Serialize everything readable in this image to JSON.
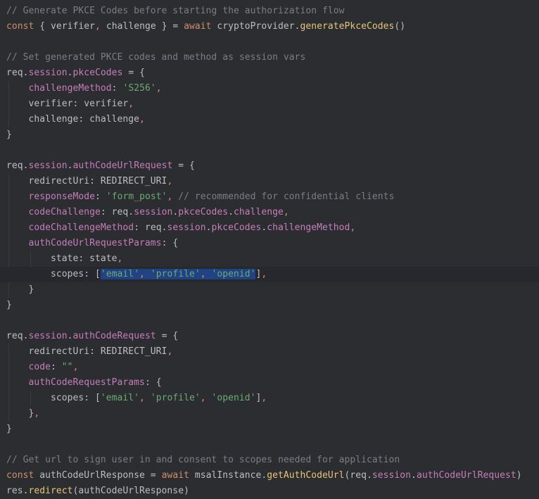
{
  "colors": {
    "background": "#2b2d30",
    "current_line": "#26282e",
    "selection": "#214283",
    "comment": "#7a7e85",
    "keyword": "#cf8e6d",
    "function": "#e8c57a",
    "property": "#c77dbb",
    "string": "#6aab73",
    "plain": "#bcbec4",
    "indent_guide": "#393b40"
  },
  "editor": {
    "current_line": 17,
    "lines": [
      [
        [
          "comment",
          "// Generate PKCE Codes before starting the authorization flow"
        ]
      ],
      [
        [
          "keyword",
          "const"
        ],
        [
          "plain",
          " { verifier"
        ],
        [
          "keyword",
          ","
        ],
        [
          "plain",
          " challenge } = "
        ],
        [
          "keyword",
          "await"
        ],
        [
          "plain",
          " cryptoProvider."
        ],
        [
          "func",
          "generatePkceCodes"
        ],
        [
          "plain",
          "()"
        ]
      ],
      [],
      [
        [
          "comment",
          "// Set generated PKCE codes and method as session vars"
        ]
      ],
      [
        [
          "plain",
          "req."
        ],
        [
          "prop",
          "session"
        ],
        [
          "plain",
          "."
        ],
        [
          "prop",
          "pkceCodes"
        ],
        [
          "plain",
          " = {"
        ]
      ],
      [
        [
          "plain",
          "    "
        ],
        [
          "prop",
          "challengeMethod"
        ],
        [
          "plain",
          ": "
        ],
        [
          "string",
          "'S256'"
        ],
        [
          "keyword",
          ","
        ]
      ],
      [
        [
          "plain",
          "    verifier: verifier"
        ],
        [
          "keyword",
          ","
        ]
      ],
      [
        [
          "plain",
          "    challenge: challenge"
        ],
        [
          "keyword",
          ","
        ]
      ],
      [
        [
          "plain",
          "}"
        ]
      ],
      [],
      [
        [
          "plain",
          "req."
        ],
        [
          "prop",
          "session"
        ],
        [
          "plain",
          "."
        ],
        [
          "prop",
          "authCodeUrlRequest"
        ],
        [
          "plain",
          " = {"
        ]
      ],
      [
        [
          "plain",
          "    redirectUri: REDIRECT_URI"
        ],
        [
          "keyword",
          ","
        ]
      ],
      [
        [
          "plain",
          "    "
        ],
        [
          "prop",
          "responseMode"
        ],
        [
          "plain",
          ": "
        ],
        [
          "string",
          "'form_post'"
        ],
        [
          "keyword",
          ","
        ],
        [
          "plain",
          " "
        ],
        [
          "comment",
          "// recommended for confidential clients"
        ]
      ],
      [
        [
          "plain",
          "    "
        ],
        [
          "prop",
          "codeChallenge"
        ],
        [
          "plain",
          ": req."
        ],
        [
          "prop",
          "session"
        ],
        [
          "plain",
          "."
        ],
        [
          "prop",
          "pkceCodes"
        ],
        [
          "plain",
          "."
        ],
        [
          "prop",
          "challenge"
        ],
        [
          "keyword",
          ","
        ]
      ],
      [
        [
          "plain",
          "    "
        ],
        [
          "prop",
          "codeChallengeMethod"
        ],
        [
          "plain",
          ": req."
        ],
        [
          "prop",
          "session"
        ],
        [
          "plain",
          "."
        ],
        [
          "prop",
          "pkceCodes"
        ],
        [
          "plain",
          "."
        ],
        [
          "prop",
          "challengeMethod"
        ],
        [
          "keyword",
          ","
        ]
      ],
      [
        [
          "plain",
          "    "
        ],
        [
          "prop",
          "authCodeUrlRequestParams"
        ],
        [
          "plain",
          ": {"
        ]
      ],
      [
        [
          "plain",
          "        state: state"
        ],
        [
          "keyword",
          ","
        ]
      ],
      [
        [
          "plain",
          "        scopes: ["
        ],
        [
          "string",
          "'email'",
          "sel"
        ],
        [
          "keyword",
          ", ",
          "sel"
        ],
        [
          "string",
          "'profile'",
          "sel"
        ],
        [
          "keyword",
          ", ",
          "sel"
        ],
        [
          "string",
          "'openid'",
          "sel"
        ],
        [
          "plain",
          "]"
        ],
        [
          "keyword",
          ","
        ]
      ],
      [
        [
          "plain",
          "    }"
        ]
      ],
      [
        [
          "plain",
          "}"
        ]
      ],
      [],
      [
        [
          "plain",
          "req."
        ],
        [
          "prop",
          "session"
        ],
        [
          "plain",
          "."
        ],
        [
          "prop",
          "authCodeRequest"
        ],
        [
          "plain",
          " = {"
        ]
      ],
      [
        [
          "plain",
          "    redirectUri: REDIRECT_URI"
        ],
        [
          "keyword",
          ","
        ]
      ],
      [
        [
          "plain",
          "    "
        ],
        [
          "prop",
          "code"
        ],
        [
          "plain",
          ": "
        ],
        [
          "string",
          "\"\""
        ],
        [
          "keyword",
          ","
        ]
      ],
      [
        [
          "plain",
          "    "
        ],
        [
          "prop",
          "authCodeRequestParams"
        ],
        [
          "plain",
          ": {"
        ]
      ],
      [
        [
          "plain",
          "        scopes: ["
        ],
        [
          "string",
          "'email'"
        ],
        [
          "keyword",
          ", "
        ],
        [
          "string",
          "'profile'"
        ],
        [
          "keyword",
          ", "
        ],
        [
          "string",
          "'openid'"
        ],
        [
          "plain",
          "]"
        ],
        [
          "keyword",
          ","
        ]
      ],
      [
        [
          "plain",
          "    }"
        ],
        [
          "keyword",
          ","
        ]
      ],
      [
        [
          "plain",
          "}"
        ]
      ],
      [],
      [
        [
          "comment",
          "// Get url to sign user in and consent to scopes needed for application"
        ]
      ],
      [
        [
          "keyword",
          "const"
        ],
        [
          "plain",
          " authCodeUrlResponse = "
        ],
        [
          "keyword",
          "await"
        ],
        [
          "plain",
          " msalInstance."
        ],
        [
          "func",
          "getAuthCodeUrl"
        ],
        [
          "plain",
          "(req."
        ],
        [
          "prop",
          "session"
        ],
        [
          "plain",
          "."
        ],
        [
          "prop",
          "authCodeUrlRequest"
        ],
        [
          "plain",
          ")"
        ]
      ],
      [
        [
          "plain",
          "res."
        ],
        [
          "func",
          "redirect"
        ],
        [
          "plain",
          "(authCodeUrlResponse)"
        ]
      ]
    ]
  }
}
